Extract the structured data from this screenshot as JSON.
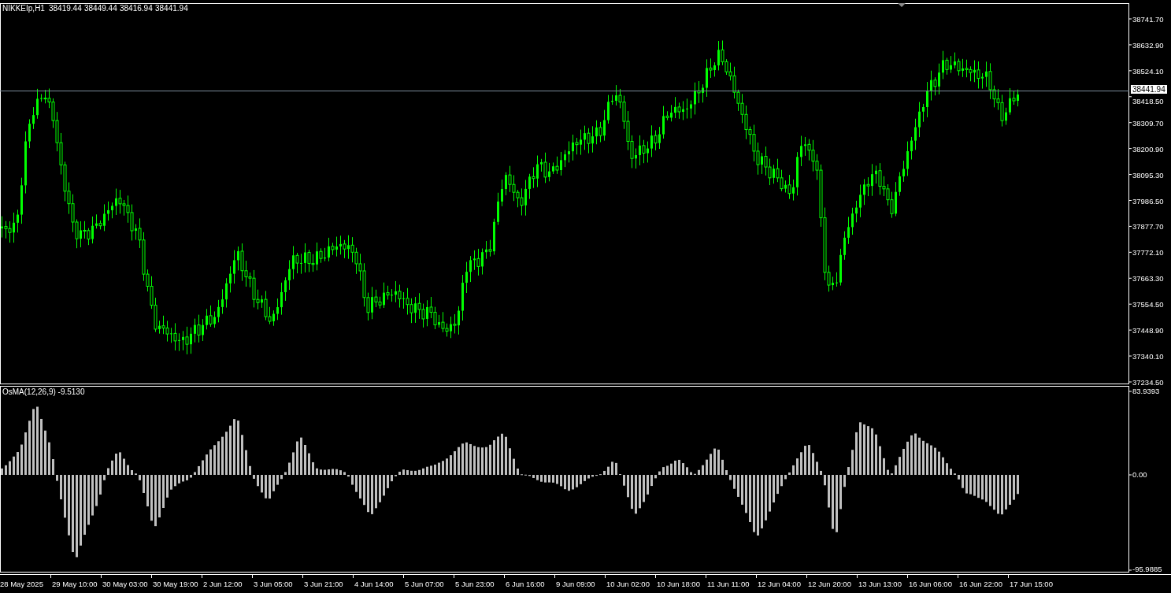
{
  "chart": {
    "symbol": "NIKKEIp,H1",
    "ohlc": [
      "38419.44",
      "38449.44",
      "38416.94",
      "38441.94"
    ],
    "current_price": "38441.94",
    "price_axis": [
      "38741.70",
      "38632.90",
      "38524.10",
      "38418.50",
      "38309.70",
      "38200.90",
      "38095.30",
      "37986.50",
      "37877.70",
      "37772.10",
      "37663.30",
      "37554.50",
      "37448.90",
      "37340.10",
      "37234.50"
    ]
  },
  "indicator": {
    "label": "OsMA(12,26,9) -9.5130",
    "axis": [
      "83.9393",
      "0.00",
      "-95.9885"
    ]
  },
  "time_axis": [
    "28 May 2025",
    "29 May 10:00",
    "30 May 03:00",
    "30 May 19:00",
    "2 Jun 12:00",
    "3 Jun 05:00",
    "3 Jun 21:00",
    "4 Jun 14:00",
    "5 Jun 07:00",
    "5 Jun 23:00",
    "6 Jun 16:00",
    "9 Jun 09:00",
    "10 Jun 02:00",
    "10 Jun 18:00",
    "11 Jun 11:00",
    "12 Jun 04:00",
    "12 Jun 20:00",
    "13 Jun 13:00",
    "16 Jun 06:00",
    "16 Jun 22:00",
    "17 Jun 15:00"
  ]
}
